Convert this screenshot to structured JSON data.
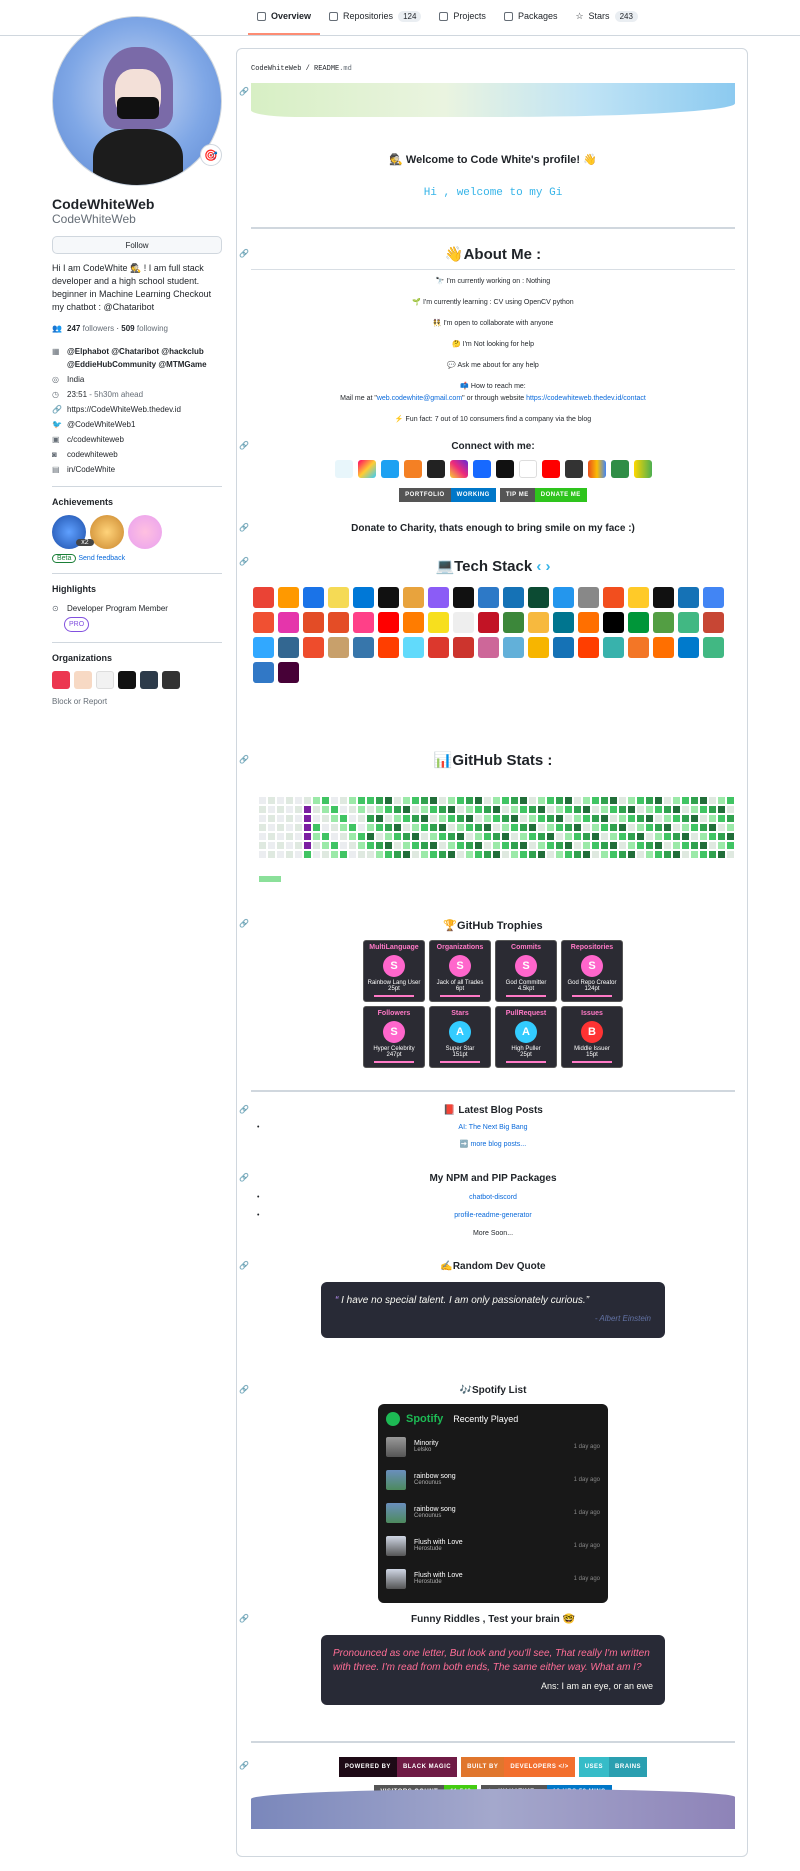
{
  "nav": {
    "tabs": [
      {
        "label": "Overview",
        "count": ""
      },
      {
        "label": "Repositories",
        "count": "124"
      },
      {
        "label": "Projects",
        "count": ""
      },
      {
        "label": "Packages",
        "count": ""
      },
      {
        "label": "Stars",
        "count": "243"
      }
    ]
  },
  "profile": {
    "name": "CodeWhiteWeb",
    "login": "CodeWhiteWeb",
    "follow": "Follow",
    "status_emoji": "🎯",
    "bio": "Hi I am CodeWhite 🕵️ ! I am full stack developer and a high school student. beginner in Machine Learning Checkout my chatbot : @Chataribot",
    "followers": "247",
    "followers_label": "followers",
    "following": "509",
    "following_label": "following",
    "orgs_text": "@Elphabot @Chataribot @hackclub @EddieHubCommunity @MTMGame",
    "location": "India",
    "time": "23:51",
    "time_ahead": "- 5h30m ahead",
    "website": "https://CodeWhiteWeb.thedev.id",
    "twitter": "@CodeWhiteWeb1",
    "youtube": "c/codewhiteweb",
    "instagram": "codewhiteweb",
    "linkedin": "in/CodeWhite"
  },
  "sidebar": {
    "achievements": "Achievements",
    "ach_count": "x2",
    "beta": "Beta",
    "send_feedback": "Send feedback",
    "highlights": "Highlights",
    "dev_program": "Developer Program Member",
    "pro": "PRO",
    "organizations": "Organizations",
    "block": "Block or Report"
  },
  "readme": {
    "path": "CodeWhiteWeb / README",
    "ext": ".md",
    "welcome": "Welcome to Code White's profile!",
    "typing": "Hi , welcome to my Gi",
    "about_title": "About Me :",
    "about": [
      "🔭 I'm currently working on : Nothing",
      "🌱 I'm currently learning : CV using OpenCV python",
      "👯 I'm open to collaborate with anyone",
      "🤔 I'm Not looking for help",
      "💬 Ask me about for any help",
      "📫 How to reach me:"
    ],
    "mail_prefix": "Mail me at \"",
    "mail": "web.codewhite@gmail.com",
    "mail_mid": "\" or through website ",
    "site": "https://codewhiteweb.thedev.id/contact",
    "funfact": "⚡ Fun fact: 7 out of 10 consumers find a company via the blog",
    "connect": "Connect with me:",
    "b_portfolio": "PORTFOLIO",
    "b_working": "WORKING",
    "b_tip": "TIP ME",
    "b_donate": "DONATE ME",
    "charity": "Donate to Charity, thats enough to bring smile on my face :)",
    "tech": "💻Tech Stack",
    "stats": "📊GitHub Stats :",
    "trophies": "🏆GitHub Trophies",
    "blog": "📕 Latest Blog Posts",
    "blog_post": "AI: The Next Big Bang",
    "more_posts": "➡️ more blog posts...",
    "packages": "My NPM and PIP Packages",
    "pkg1": "chatbot-discord",
    "pkg2": "profile-readme-generator",
    "more_soon": "More Soon...",
    "quote_title": "✍️Random Dev Quote",
    "quote": "I have no special talent. I am only passionately curious.",
    "quote_author": "- Albert Einstein",
    "spotify_title": "🎶Spotify List",
    "spotify": "Spotify",
    "recent": "Recently Played",
    "riddle_title": "Funny Riddles , Test your brain 🤓",
    "riddle": "Pronounced as one letter, But look and you'll see, That really I'm written with three. I'm read from both ends, The same either way. What am I?",
    "riddle_ans": "Ans: I am an eye, or an ewe",
    "f1a": "POWERED BY",
    "f1b": "BLACK MAGIC",
    "f2a": "BUILT BY",
    "f2b": "DEVELOPERS </>",
    "f3a": "USES",
    "f3b": "BRAINS",
    "visitors": "VISITORS COUNT",
    "visitors_n": "11,548",
    "wakatime": "WAKATIME",
    "wakatime_v": "19 HRS 58 MINS"
  },
  "trophies": [
    {
      "title": "MultiLanguage",
      "rank": "S",
      "name": "Rainbow Lang User",
      "pt": "25pt"
    },
    {
      "title": "Organizations",
      "rank": "S",
      "name": "Jack of all Trades",
      "pt": "6pt"
    },
    {
      "title": "Commits",
      "rank": "S",
      "name": "God Committer",
      "pt": "4.5kpt"
    },
    {
      "title": "Repositories",
      "rank": "S",
      "name": "God Repo Creator",
      "pt": "124pt"
    },
    {
      "title": "Followers",
      "rank": "S",
      "name": "Hyper Celebrity",
      "pt": "247pt"
    },
    {
      "title": "Stars",
      "rank": "A",
      "name": "Super Star",
      "pt": "151pt"
    },
    {
      "title": "PullRequest",
      "rank": "A",
      "name": "High Puller",
      "pt": "25pt"
    },
    {
      "title": "Issues",
      "rank": "B",
      "name": "Middle Issuer",
      "pt": "15pt"
    }
  ],
  "tracks": [
    {
      "title": "Minority",
      "artist": "Lelsko",
      "ago": "1 day ago"
    },
    {
      "title": "rainbow song",
      "artist": "Cenounus",
      "ago": "1 day ago"
    },
    {
      "title": "rainbow song",
      "artist": "Cenounus",
      "ago": "1 day ago"
    },
    {
      "title": "Flush with Love",
      "artist": "Herostude",
      "ago": "1 day ago"
    },
    {
      "title": "Flush with Love",
      "artist": "Herostude",
      "ago": "1 day ago"
    }
  ],
  "colors": {
    "accent": "#fd8c73",
    "link": "#0969da",
    "green": "#40c463",
    "trophy_bg": "#2b2b33"
  }
}
